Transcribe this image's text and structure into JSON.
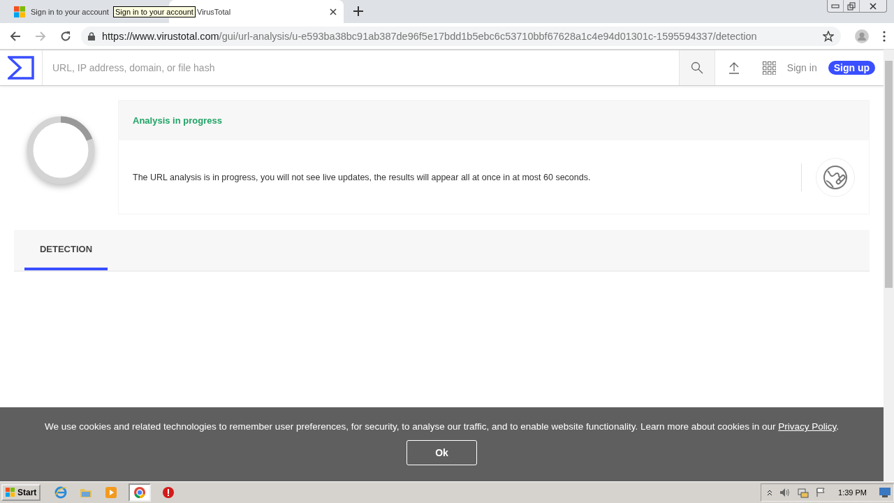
{
  "tabs": [
    {
      "title": "Sign in to your account",
      "selected": false,
      "kind": "microsoft"
    },
    {
      "title": "VirusTotal",
      "selected": true,
      "kind": "blank"
    }
  ],
  "tooltip": "Sign in to your account",
  "address": {
    "host": "https://www.virustotal.com",
    "path": "/gui/url-analysis/u-e593ba38bc91ab387de96f5e17bdd1b5ebc6c53710bbf67628a1c4e94d01301c-1595594337/detection"
  },
  "header": {
    "search_placeholder": "URL, IP address, domain, or file hash",
    "sign_in": "Sign in",
    "sign_up": "Sign up"
  },
  "analysis": {
    "status": "Analysis in progress",
    "message": "The URL analysis is in progress, you will not see live updates, the results will appear all at once in at most 60 seconds."
  },
  "report_tabs": [
    {
      "label": "DETECTION",
      "selected": true
    }
  ],
  "cookie_banner": {
    "text": "We use cookies and related technologies to remember user preferences, for security, to analyse our traffic, and to enable website functionality. Learn more about cookies in our ",
    "link": "Privacy Policy",
    "end": ".",
    "button": "Ok"
  },
  "taskbar": {
    "start": "Start",
    "apps": [
      {
        "kind": "ie",
        "selected": false
      },
      {
        "kind": "folder",
        "selected": false
      },
      {
        "kind": "media",
        "selected": false
      },
      {
        "kind": "chrome",
        "selected": true
      },
      {
        "kind": "stop",
        "selected": false
      }
    ],
    "clock": "1:39 PM"
  }
}
